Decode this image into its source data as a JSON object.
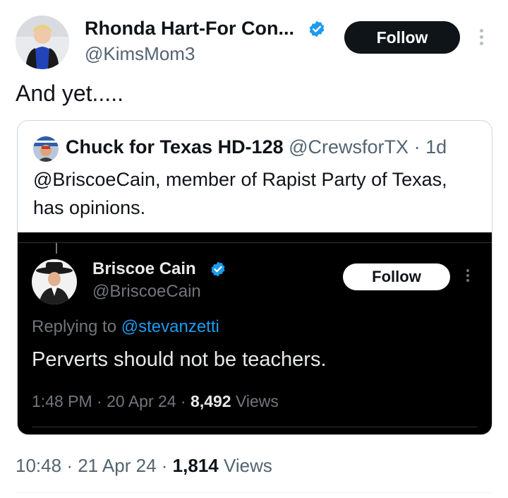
{
  "tweet": {
    "author_name": "Rhonda Hart-For Con...",
    "author_handle": "@KimsMom3",
    "follow_label": "Follow",
    "text": "And yet.....",
    "time": "10:48",
    "sep1": "·",
    "date": "21 Apr 24",
    "sep2": "·",
    "views_count": "1,814",
    "views_label": "Views"
  },
  "quote": {
    "author_name": "Chuck for Texas HD-128",
    "author_handle": "@CrewsforTX",
    "sep": "·",
    "age": "1d",
    "text_line1": "@BriscoeCain, member of Rapist Party of Texas,",
    "text_line2": "has opinions."
  },
  "embedded": {
    "author_name": "Briscoe Cain",
    "author_handle": "@BriscoeCain",
    "follow_label": "Follow",
    "replying_prefix": "Replying to",
    "replying_handle": "@stevanzetti",
    "text": "Perverts should not be teachers.",
    "time": "1:48 PM",
    "sep1": "·",
    "date": "20 Apr 24",
    "sep2": "·",
    "views_count": "8,492",
    "views_label": "Views"
  },
  "colors": {
    "accent": "#1d9bf0",
    "verified": "#1d9bf0",
    "text_secondary": "#536471",
    "dark_bg": "#000000"
  },
  "icons": {
    "verified": "verified-badge-icon",
    "more": "more-dots-icon"
  }
}
